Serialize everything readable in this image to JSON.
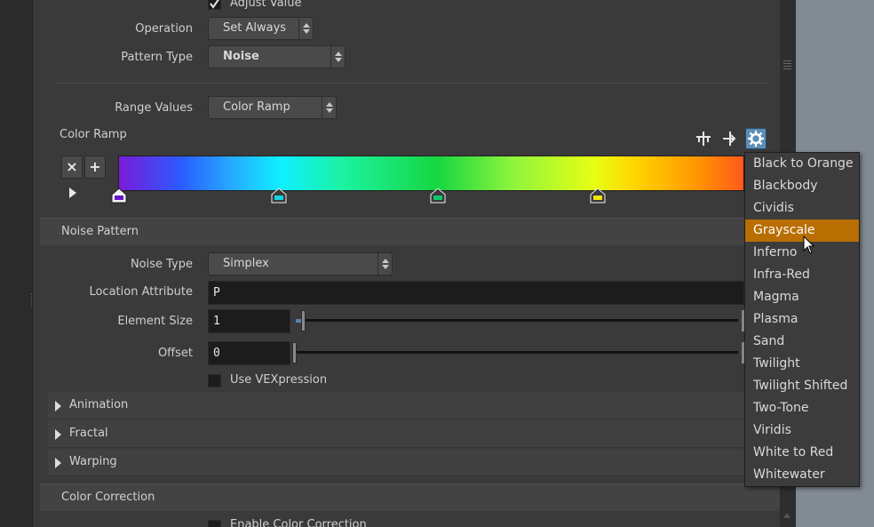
{
  "adjust_value": {
    "label": "Adjust Value",
    "checked": true
  },
  "operation": {
    "label": "Operation",
    "value": "Set Always"
  },
  "pattern_type": {
    "label": "Pattern Type",
    "value": "Noise"
  },
  "range_values": {
    "label": "Range Values",
    "value": "Color Ramp"
  },
  "color_ramp": {
    "label": "Color Ramp",
    "remove_label": "×",
    "add_label": "+",
    "key_colors": [
      "#6a14c8",
      "#0fd4e6",
      "#10c86a",
      "#f0e20c"
    ]
  },
  "noise_pattern": {
    "title": "Noise Pattern",
    "noise_type": {
      "label": "Noise Type",
      "value": "Simplex"
    },
    "location_attribute": {
      "label": "Location Attribute",
      "value": "P"
    },
    "element_size": {
      "label": "Element Size",
      "value": "1"
    },
    "offset": {
      "label": "Offset",
      "value": "0"
    },
    "use_vexpression": {
      "label": "Use VEXpression",
      "checked": false
    }
  },
  "folders": [
    {
      "label": "Animation"
    },
    {
      "label": "Fractal"
    },
    {
      "label": "Warping"
    }
  ],
  "color_correction": {
    "title": "Color Correction",
    "enable": {
      "label": "Enable Color Correction",
      "checked": false
    }
  },
  "preset_menu": {
    "items": [
      "Black to Orange",
      "Blackbody",
      "Cividis",
      "Grayscale",
      "Inferno",
      "Infra-Red",
      "Magma",
      "Plasma",
      "Sand",
      "Twilight",
      "Twilight Shifted",
      "Two-Tone",
      "Viridis",
      "White to Red",
      "Whitewater"
    ],
    "highlighted": "Grayscale"
  },
  "colors": {
    "accent": "#b86e00",
    "panel": "#3a3a3a",
    "field": "#1c1c1c"
  }
}
